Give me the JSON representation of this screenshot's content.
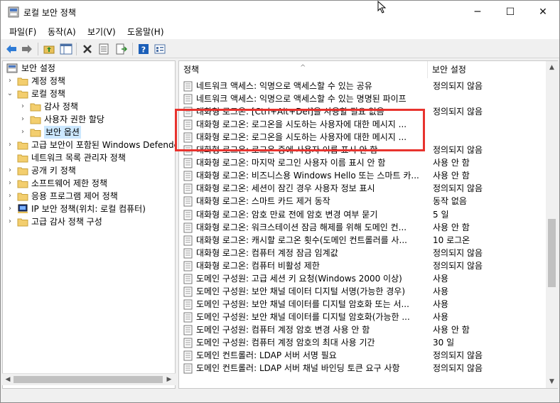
{
  "window": {
    "title": "로컬 보안 정책",
    "minimize_glyph": "─",
    "maximize_glyph": "☐",
    "close_glyph": "✕"
  },
  "menu": [
    "파일(F)",
    "동작(A)",
    "보기(V)",
    "도움말(H)"
  ],
  "toolbar": {
    "buttons": [
      "back-arrow-icon",
      "forward-arrow-icon",
      "up-folder-icon",
      "show-hide-tree-icon",
      "delete-icon",
      "properties-icon",
      "export-list-icon",
      "help-icon",
      "view-icon"
    ]
  },
  "tree": {
    "root": "보안 설정",
    "items": [
      {
        "label": "계정 정책",
        "toggle": "›",
        "level": 1
      },
      {
        "label": "로컬 정책",
        "toggle": "⌄",
        "level": 1
      },
      {
        "label": "감사 정책",
        "toggle": "›",
        "level": 2
      },
      {
        "label": "사용자 권한 할당",
        "toggle": "›",
        "level": 2
      },
      {
        "label": "보안 옵션",
        "toggle": "›",
        "level": 2,
        "selected": true
      },
      {
        "label": "고급 보안이 포함된 Windows Defender",
        "toggle": "›",
        "level": 1
      },
      {
        "label": "네트워크 목록 관리자 정책",
        "toggle": "",
        "level": 1
      },
      {
        "label": "공개 키 정책",
        "toggle": "›",
        "level": 1
      },
      {
        "label": "소프트웨어 제한 정책",
        "toggle": "›",
        "level": 1
      },
      {
        "label": "응용 프로그램 제어 정책",
        "toggle": "›",
        "level": 1
      },
      {
        "label": "IP 보안 정책(위치: 로컬 컴퓨터)",
        "toggle": "›",
        "level": 1,
        "icon": "ip-security-icon"
      },
      {
        "label": "고급 감사 정책 구성",
        "toggle": "›",
        "level": 1
      }
    ]
  },
  "list": {
    "columns": {
      "policy": "정책",
      "setting": "보안 설정"
    },
    "rows": [
      {
        "policy": "네트워크 액세스: 익명으로 액세스할 수 있는 공유",
        "setting": "정의되지 않음"
      },
      {
        "policy": "네트워크 액세스: 익명으로 액세스할 수 있는 명명된 파이프",
        "setting": ""
      },
      {
        "policy": "대화형 로그온: [Ctrl+Alt+Del]을 사용할 필요 없음",
        "setting": "정의되지 않음"
      },
      {
        "policy": "대화형 로그온: 로그온을 시도하는 사용자에 대한 메시지 ...",
        "setting": ""
      },
      {
        "policy": "대화형 로그온: 로그온을 시도하는 사용자에 대한 메시지 ...",
        "setting": ""
      },
      {
        "policy": "대화형 로그온: 로그온 중에 사용자 이름 표시 안 함",
        "setting": "정의되지 않음"
      },
      {
        "policy": "대화형 로그온: 마지막 로그인 사용자 이름 표시 안 함",
        "setting": "사용 안 함"
      },
      {
        "policy": "대화형 로그온: 비즈니스용 Windows Hello 또는 스마트 카...",
        "setting": "사용 안 함"
      },
      {
        "policy": "대화형 로그온: 세션이 잠긴 경우 사용자 정보 표시",
        "setting": "정의되지 않음"
      },
      {
        "policy": "대화형 로그온: 스마트 카드 제거 동작",
        "setting": "동작 없음"
      },
      {
        "policy": "대화형 로그온: 암호 만료 전에 암호 변경 여부 묻기",
        "setting": "5 일"
      },
      {
        "policy": "대화형 로그온: 워크스테이션 잠금 해제를 위해 도메인 컨...",
        "setting": "사용 안 함"
      },
      {
        "policy": "대화형 로그온: 캐시할 로그온 횟수(도메인 컨트롤러를 사...",
        "setting": "10 로그온"
      },
      {
        "policy": "대화형 로그온: 컴퓨터 계정 잠금 임계값",
        "setting": "정의되지 않음"
      },
      {
        "policy": "대화형 로그온: 컴퓨터 비활성 제한",
        "setting": "정의되지 않음"
      },
      {
        "policy": "도메인 구성원: 고급 세션 키 요청(Windows 2000 이상)",
        "setting": "사용"
      },
      {
        "policy": "도메인 구성원: 보안 채널 데이터 디지털 서명(가능한 경우)",
        "setting": "사용"
      },
      {
        "policy": "도메인 구성원: 보안 채널 데이터를 디지털 암호화 또는 서...",
        "setting": "사용"
      },
      {
        "policy": "도메인 구성원: 보안 채널 데이터를 디지털 암호화(가능한 ...",
        "setting": "사용"
      },
      {
        "policy": "도메인 구성원: 컴퓨터 계정 암호 변경 사용 안 함",
        "setting": "사용 안 함"
      },
      {
        "policy": "도메인 구성원: 컴퓨터 계정 암호의 최대 사용 기간",
        "setting": "30 일"
      },
      {
        "policy": "도메인 컨트롤러: LDAP 서버 서명 필요",
        "setting": "정의되지 않음"
      },
      {
        "policy": "도메인 컨트롤러: LDAP 서버 채널 바인딩 토큰 요구 사항",
        "setting": "정의되지 않음"
      }
    ]
  },
  "colors": {
    "highlight_border": "#e8332e",
    "selection_bg": "#cce8ff"
  }
}
